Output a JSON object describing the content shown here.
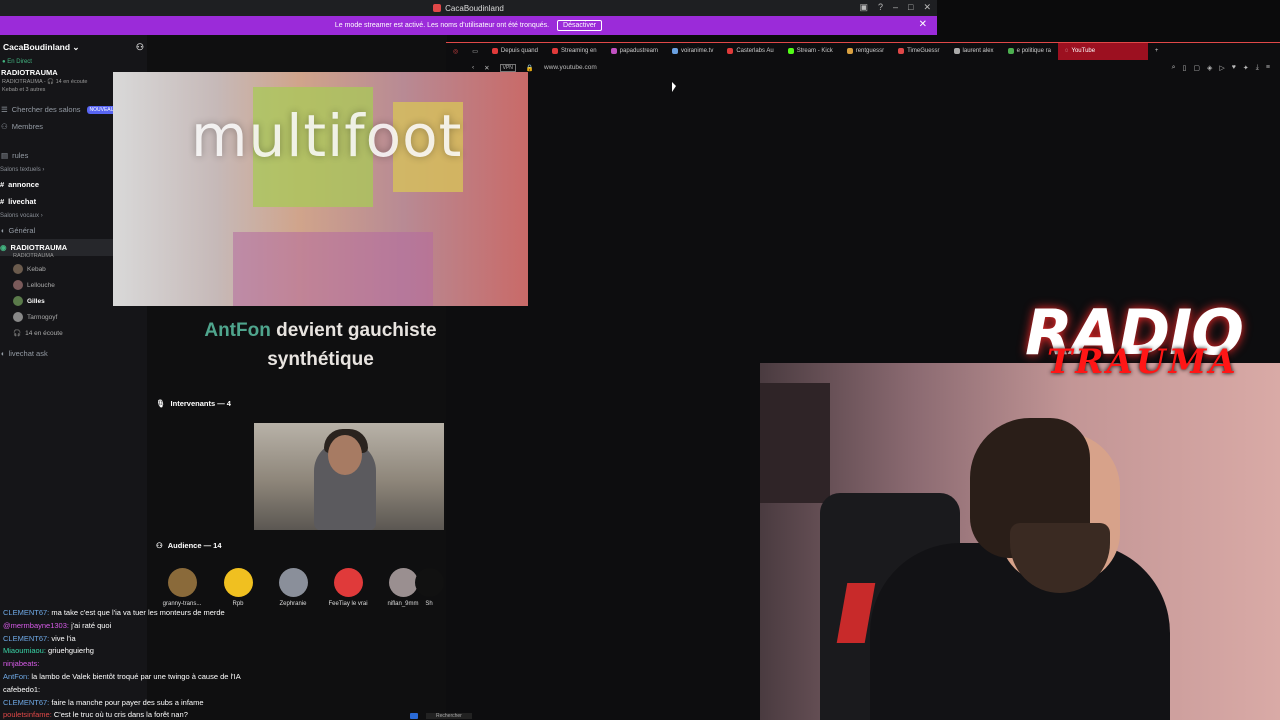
{
  "discord": {
    "window_title": "CacaBoudinland",
    "streamer_banner": "Le mode streamer est activé. Les noms d'utilisateur ont été tronqués.",
    "streamer_button": "Désactiver",
    "server_name": "CacaBoudinland",
    "live_label": "● En Direct",
    "live_channel": "RADIOTRAUMA",
    "live_sub": "RADIOTRAUMA - 🎧 14 en écoute",
    "live_sub2": "Kebab et 3 autres",
    "browse_label": "Chercher des salons",
    "browse_tag": "NOUVEAU",
    "members_label": "Membres",
    "rules_label": "rules",
    "text_cat": "Salons textuels",
    "channels_text": [
      "annonce",
      "livechat"
    ],
    "voice_cat": "Salons vocaux",
    "voice_general": "Général",
    "voice_active": "RADIOTRAUMA",
    "voice_active_sub": "RADIOTRAUMA",
    "voice_users": [
      "Kebab",
      "Lellouche",
      "Gilles",
      "Tarmogoyf"
    ],
    "listening": "14 en écoute",
    "livechat_ask": "livechat ask"
  },
  "stage": {
    "video_title": "multifoot",
    "headline_hl": "AntFon",
    "headline_rest": " devient gauchiste synthétique",
    "speakers_label": "Intervenants — 4",
    "audience_label": "Audience — 14",
    "audience": [
      {
        "name": "granny-trans...",
        "color": "#8a6a3a"
      },
      {
        "name": "Rpb",
        "color": "#f0c020"
      },
      {
        "name": "Zephranie",
        "color": "#8a8f9a"
      },
      {
        "name": "FeeTiay le vrai",
        "color": "#e03a3a"
      },
      {
        "name": "niflan_9mm",
        "color": "#9a8f90"
      },
      {
        "name": "Sh",
        "color": "#555"
      }
    ]
  },
  "chat": [
    {
      "user": "CLEMENT67:",
      "text": " ma take c'est que l'ia va tuer les monteurs de merde",
      "cls": "u1"
    },
    {
      "user": "@mermbayne1303:",
      "text": " j'ai raté quoi",
      "cls": "u2"
    },
    {
      "user": "CLEMENT67:",
      "text": " vive l'ia",
      "cls": "u1"
    },
    {
      "user": "Miaoumiaou:",
      "text": " griuehguierhg",
      "cls": "u3"
    },
    {
      "user": "ninjabeats:",
      "text": "",
      "cls": "u2"
    },
    {
      "user": "AntFon:",
      "text": " la lambo de Valek bientôt troqué par une twingo à cause de l'IA",
      "cls": "u1"
    },
    {
      "user": "cafebedo1:",
      "text": "",
      "cls": "u5"
    },
    {
      "user": "CLEMENT67:",
      "text": " faire la manche pour payer des subs a infame",
      "cls": "u1"
    },
    {
      "user": "pouletsinfame:",
      "text": " C'est le truc où tu cris dans la forêt nan?",
      "cls": "u4"
    }
  ],
  "browser": {
    "tabs": [
      {
        "label": "Depuis quand",
        "color": "#e03a3a"
      },
      {
        "label": "Streaming en",
        "color": "#e03a3a"
      },
      {
        "label": "papadustream",
        "color": "#c050c0"
      },
      {
        "label": "voiranime.tv",
        "color": "#6aa0e0"
      },
      {
        "label": "Casterlabs Au",
        "color": "#e03a3a"
      },
      {
        "label": "Stream - Kick",
        "color": "#53fc18"
      },
      {
        "label": "rentguessr",
        "color": "#d9a040"
      },
      {
        "label": "TimeGuessr",
        "color": "#e04848"
      },
      {
        "label": "laurent alex",
        "color": "#aaaaaa"
      },
      {
        "label": "e politique ra",
        "color": "#4caf50"
      }
    ],
    "active_tab": "YouTube",
    "url": "www.youtube.com",
    "vpn": "VPN"
  },
  "overlay": {
    "radio": "RADIO",
    "trauma": "TRAUMA"
  },
  "taskbar": {
    "search": "Rechercher"
  }
}
